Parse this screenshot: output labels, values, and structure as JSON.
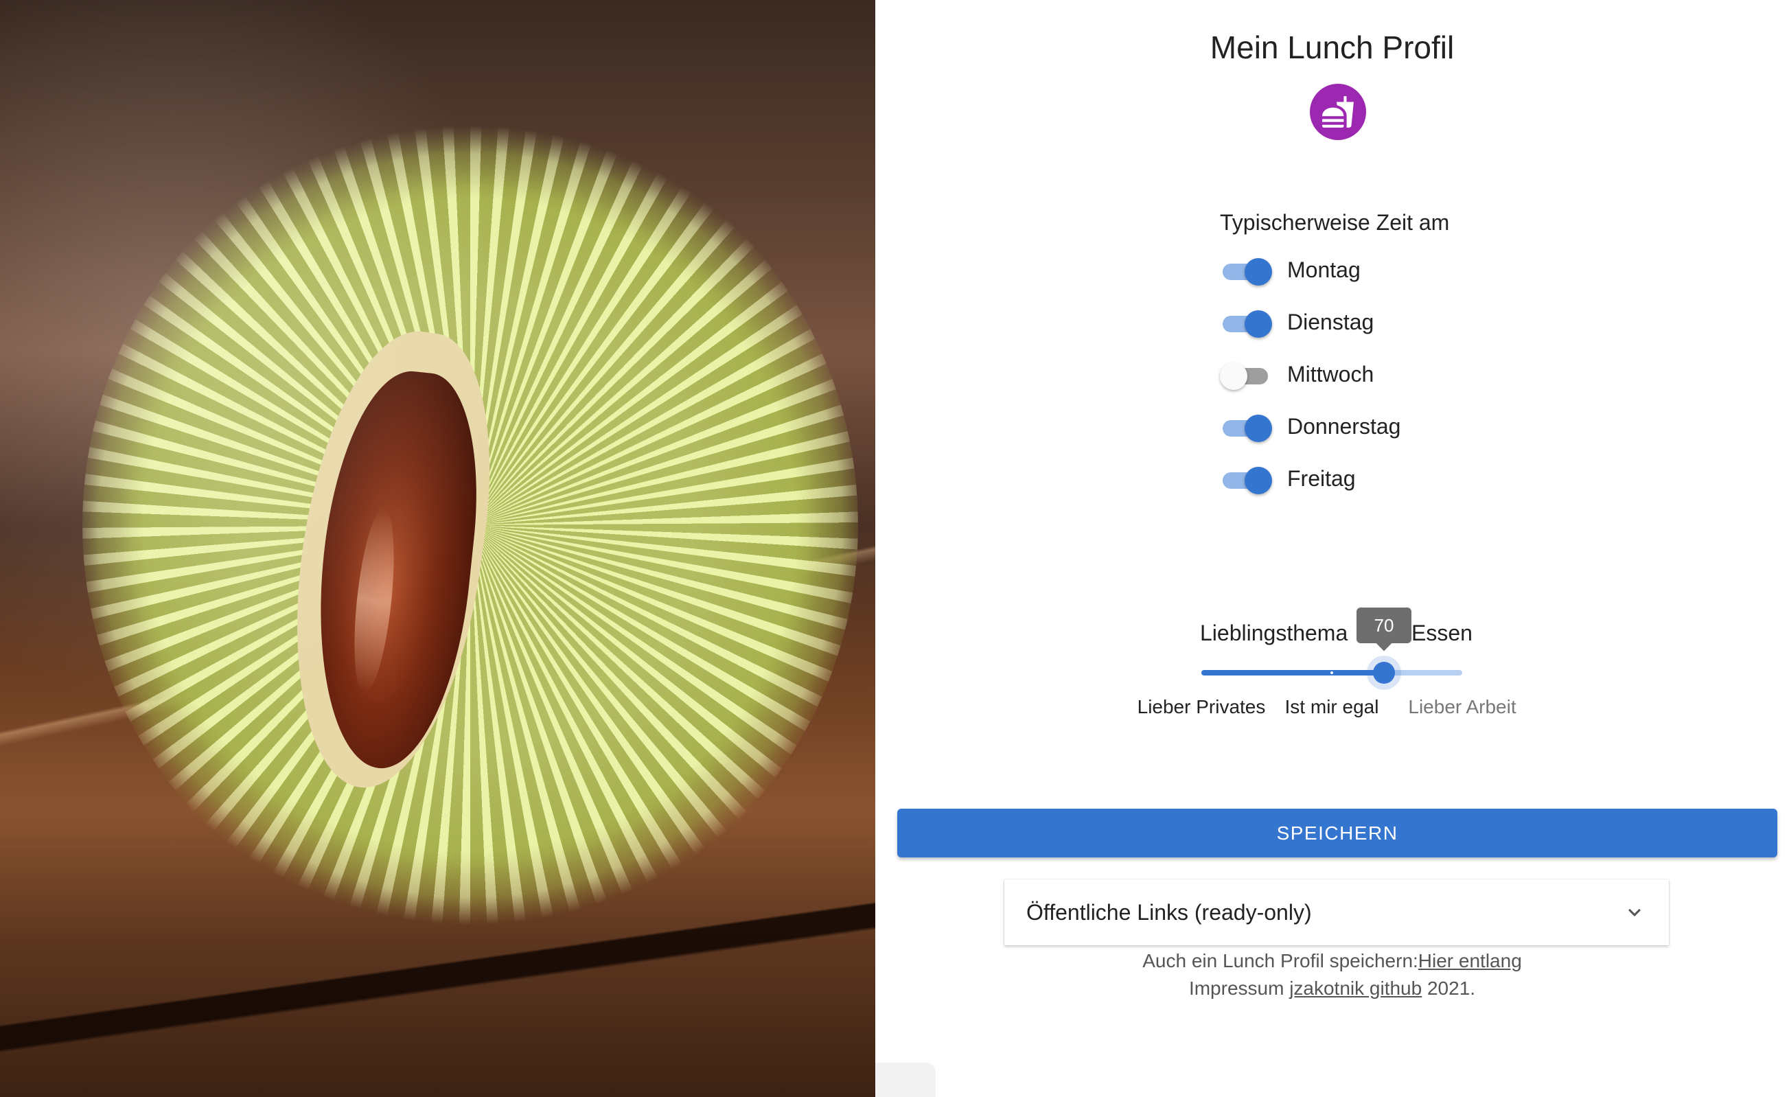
{
  "title": "Mein Lunch Profil",
  "avatar_icon": "fastfood-icon",
  "accent_color": "#3475d0",
  "avatar_color": "#9c27b0",
  "days": {
    "label": "Typischerweise Zeit am",
    "items": [
      {
        "label": "Montag",
        "on": true
      },
      {
        "label": "Dienstag",
        "on": true
      },
      {
        "label": "Mittwoch",
        "on": false
      },
      {
        "label": "Donnerstag",
        "on": true
      },
      {
        "label": "Freitag",
        "on": true
      }
    ]
  },
  "topic": {
    "label_left": "Lieblingsthema",
    "label_right": "Essen",
    "value": 70,
    "value_label": "70",
    "min": 0,
    "max": 100,
    "marks": [
      {
        "value": 0,
        "label": "Lieber Privates"
      },
      {
        "value": 50,
        "label": "Ist mir egal"
      },
      {
        "value": 100,
        "label": "Lieber Arbeit"
      }
    ]
  },
  "save_label": "SPEICHERN",
  "public_links": {
    "title": "Öffentliche Links (ready-only)",
    "expand_icon": "chevron-down-icon"
  },
  "footer": {
    "line1_text": "Auch ein Lunch Profil speichern:",
    "line1_link": "Hier entlang",
    "line2_text": "Impressum",
    "line2_link": "jzakotnik github",
    "line2_suffix": " 2021."
  }
}
